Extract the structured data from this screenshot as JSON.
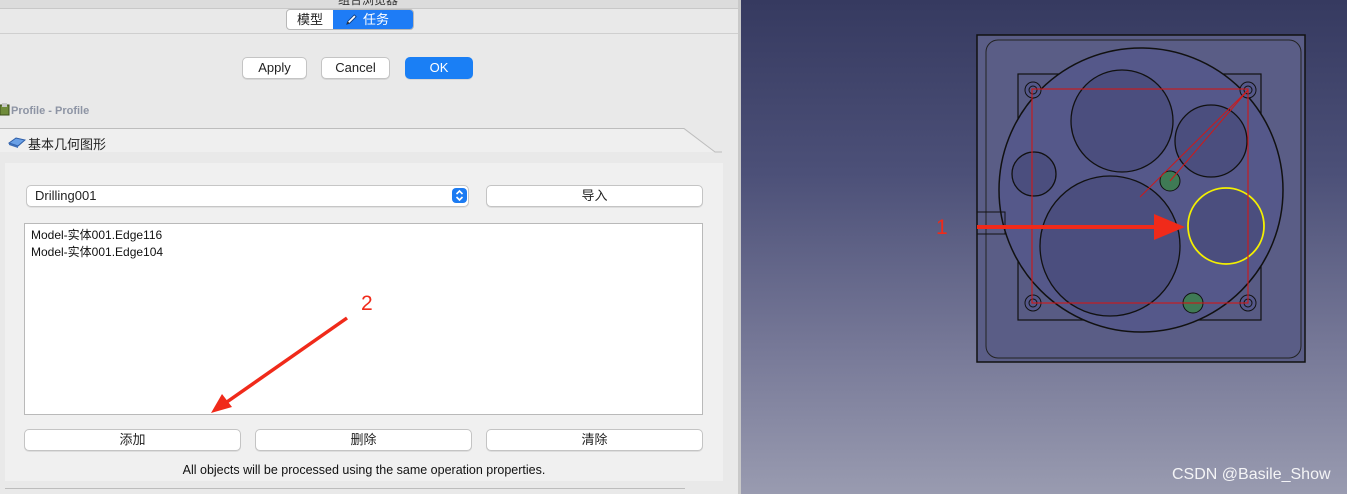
{
  "window": {
    "title_fragment": "组合浏览器"
  },
  "tabs": [
    {
      "label": "模型"
    },
    {
      "label": "任务"
    }
  ],
  "dialog_buttons": {
    "apply": "Apply",
    "cancel": "Cancel",
    "ok": "OK"
  },
  "task_label": "Profile - Profile",
  "group": {
    "title": "基本几何图形"
  },
  "selector": {
    "value": "Drilling001",
    "import_label": "导入"
  },
  "list_items": [
    "Model-实体001.Edge116",
    "Model-实体001.Edge104"
  ],
  "action_buttons": {
    "add": "添加",
    "remove": "删除",
    "clear": "清除"
  },
  "note": "All objects will be processed using the same operation properties.",
  "annotations": {
    "arrow1_label": "1",
    "arrow2_label": "2",
    "arrow_color": "#f02a1a"
  },
  "colors": {
    "accent": "#1a7ff5",
    "selection_yellow": "#f4f000",
    "sketch_red": "#d01818"
  },
  "watermark": "CSDN @Basile_Show"
}
